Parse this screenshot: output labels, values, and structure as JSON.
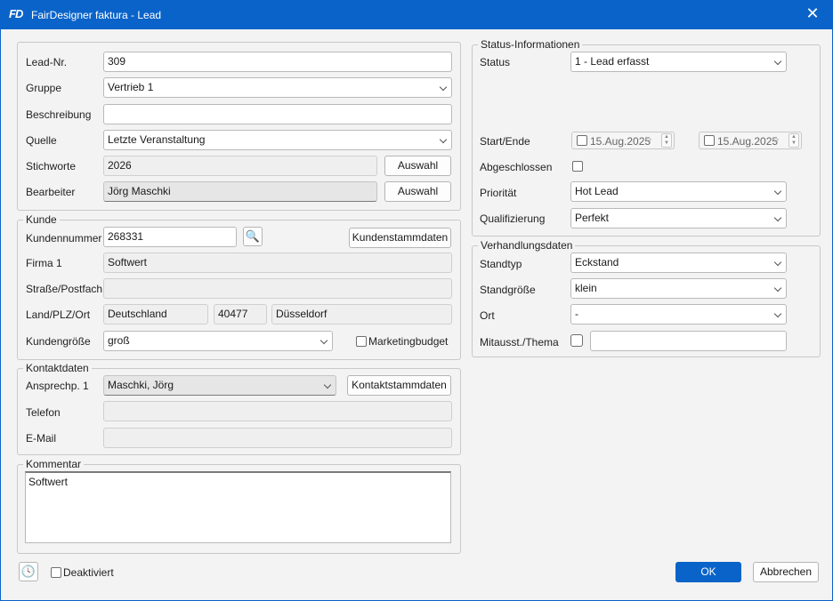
{
  "window": {
    "logo": "FD",
    "title": "FairDesigner faktura - Lead",
    "close_glyph": "✕"
  },
  "lead": {
    "lead_nr_label": "Lead-Nr.",
    "lead_nr": "309",
    "gruppe_label": "Gruppe",
    "gruppe": "Vertrieb 1",
    "beschreibung_label": "Beschreibung",
    "beschreibung": "",
    "quelle_label": "Quelle",
    "quelle": "Letzte Veranstaltung",
    "stichworte_label": "Stichworte",
    "stichworte": "2026",
    "bearbeiter_label": "Bearbeiter",
    "bearbeiter": "Jörg Maschki",
    "auswahl_label": "Auswahl"
  },
  "kunde": {
    "title": "Kunde",
    "kundennummer_label": "Kundennummer",
    "kundennummer": "268331",
    "search_glyph": "🔍",
    "stammdaten_button": "Kundenstammdaten",
    "firma_label": "Firma 1",
    "firma": "Softwert",
    "strasse_label": "Straße/Postfach",
    "strasse": "",
    "land_label": "Land/PLZ/Ort",
    "land": "Deutschland",
    "plz": "40477",
    "ort": "Düsseldorf",
    "groesse_label": "Kundengröße",
    "groesse": "groß",
    "marketing_label": "Marketingbudget"
  },
  "kontakt": {
    "title": "Kontaktdaten",
    "ansprech_label": "Ansprechp. 1",
    "ansprech": "Maschki, Jörg",
    "stammdaten_button": "Kontaktstammdaten",
    "telefon_label": "Telefon",
    "telefon": "",
    "email_label": "E-Mail",
    "email": ""
  },
  "kommentar": {
    "title": "Kommentar",
    "text": "Softwert"
  },
  "status": {
    "title": "Status-Informationen",
    "status_label": "Status",
    "status": "1 - Lead erfasst",
    "start_ende_label": "Start/Ende",
    "start_date": "15.Aug.2025",
    "end_date": "15.Aug.2025",
    "abgeschlossen_label": "Abgeschlossen",
    "prioritaet_label": "Priorität",
    "prioritaet": "Hot Lead",
    "qualifizierung_label": "Qualifizierung",
    "qualifizierung": "Perfekt"
  },
  "verhandlung": {
    "title": "Verhandlungsdaten",
    "standtyp_label": "Standtyp",
    "standtyp": "Eckstand",
    "standgroesse_label": "Standgröße",
    "standgroesse": "klein",
    "ort_label": "Ort",
    "ort": "-",
    "mitaussteller_label": "Mitausst./Thema",
    "mitaussteller": ""
  },
  "footer": {
    "clock_glyph": "🕓",
    "deaktiviert_label": "Deaktiviert",
    "ok_label": "OK",
    "abbrechen_label": "Abbrechen"
  }
}
